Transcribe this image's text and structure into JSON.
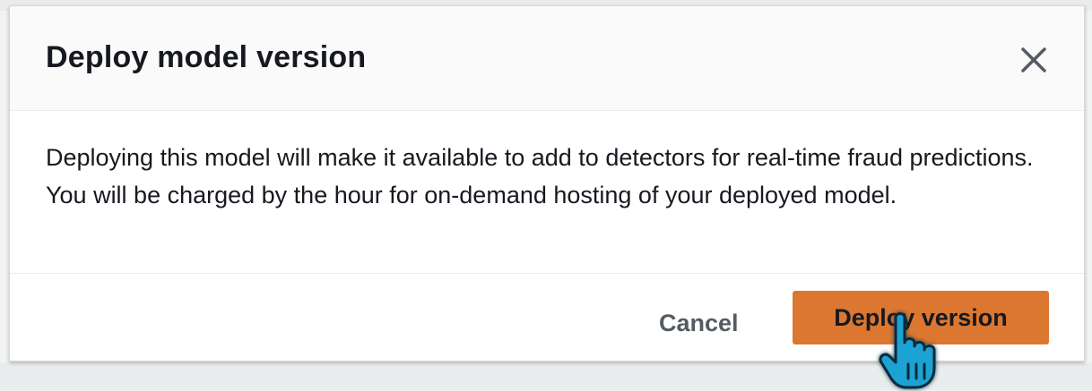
{
  "modal": {
    "title": "Deploy model version",
    "body": "Deploying this model will make it available to add to detectors for real-time fraud predictions. You will be charged by the hour for on-demand hosting of your deployed model.",
    "cancel_label": "Cancel",
    "deploy_label": "Deploy version"
  },
  "icons": {
    "close": "close-icon",
    "cursor": "hand-pointer-icon"
  },
  "colors": {
    "primary_button": "#dc7731",
    "title_text": "#16191f",
    "secondary_text": "#545b64",
    "cursor_fill": "#1aa3d4"
  }
}
